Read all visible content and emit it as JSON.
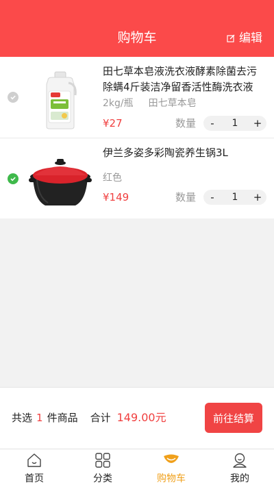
{
  "header": {
    "title": "购物车",
    "edit_label": "编辑"
  },
  "cart": {
    "items": [
      {
        "name": "田七草本皂液洗衣液酵素除菌去污除螨4斤装洁净留香活性酶洗衣液",
        "spec": "2kg/瓶",
        "brand": "田七草本皂",
        "price": "¥27",
        "qty_label": "数量",
        "quantity": "1",
        "selected": false
      },
      {
        "name": "伊兰多姿多彩陶瓷养生锅3L",
        "spec": "红色",
        "brand": "",
        "price": "¥149",
        "qty_label": "数量",
        "quantity": "1",
        "selected": true
      }
    ],
    "minus_label": "-",
    "plus_label": "+"
  },
  "summary": {
    "selected_prefix": "共选",
    "selected_count": "1",
    "selected_suffix": "件商品",
    "total_label": "合计",
    "total_value": "149.00元",
    "checkout_label": "前往结算"
  },
  "tabbar": {
    "tabs": [
      {
        "label": "首页",
        "icon": "home-icon"
      },
      {
        "label": "分类",
        "icon": "category-icon"
      },
      {
        "label": "购物车",
        "icon": "cart-icon"
      },
      {
        "label": "我的",
        "icon": "profile-icon"
      }
    ],
    "active_index": 2
  },
  "colors": {
    "header_red": "#fb4a4a",
    "price_red": "#f03f3f",
    "checkout_red": "#f04444",
    "check_green": "#3fb94b",
    "active_tab": "#f0a01b"
  }
}
